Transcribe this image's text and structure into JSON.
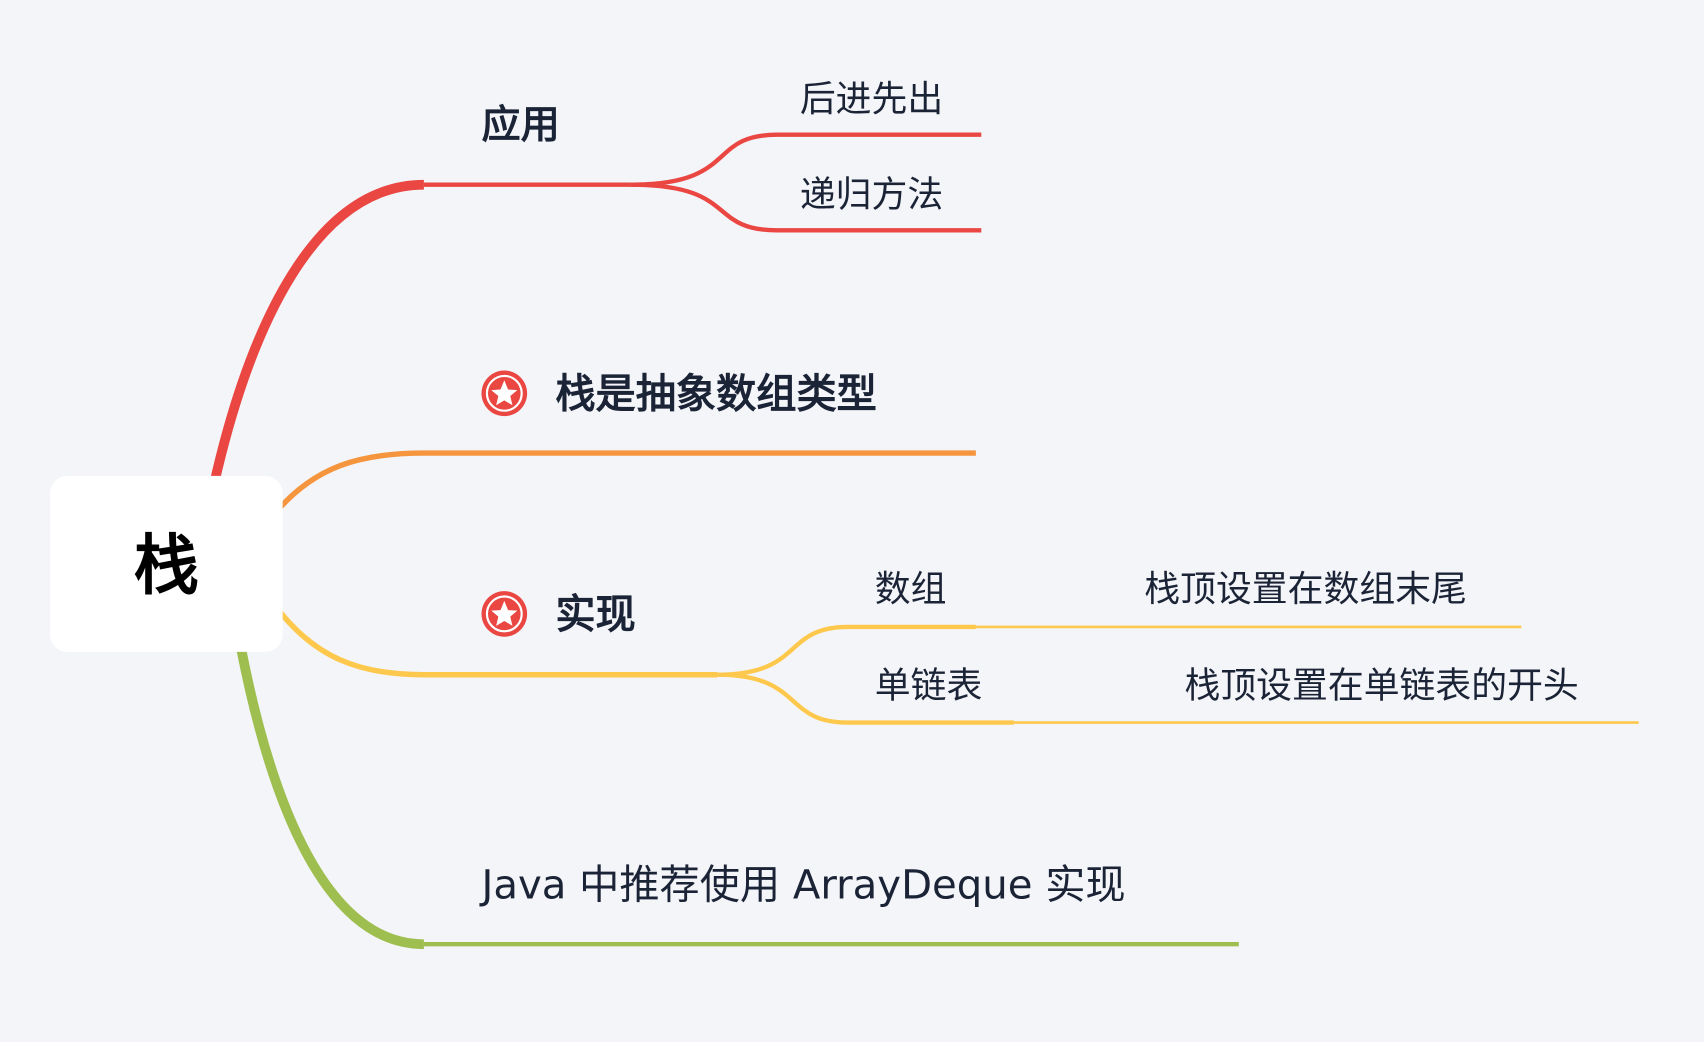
{
  "root": {
    "label": "栈"
  },
  "branches": {
    "apply": {
      "label": "应用",
      "children": [
        "后进先出",
        "递归方法"
      ]
    },
    "adt": {
      "label": "栈是抽象数组类型",
      "icon": "star-icon"
    },
    "impl": {
      "label": "实现",
      "icon": "star-icon",
      "children": [
        {
          "label": "数组",
          "note": "栈顶设置在数组末尾"
        },
        {
          "label": "单链表",
          "note": "栈顶设置在单链表的开头"
        }
      ]
    },
    "java": {
      "label": "Java 中推荐使用 ArrayDeque 实现"
    }
  },
  "colors": {
    "red": "#ea4642",
    "orange": "#f5963f",
    "yellow": "#fdc84c",
    "green": "#9ebf4f",
    "background": "#f4f5f9",
    "text": "#1b2436"
  }
}
